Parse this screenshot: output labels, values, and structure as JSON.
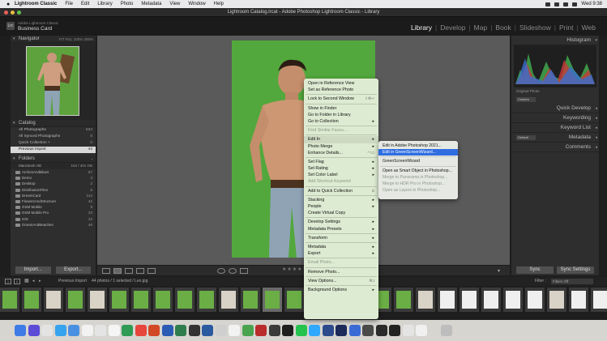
{
  "menubar": {
    "app": "Lightroom Classic",
    "items": [
      "File",
      "Edit",
      "Library",
      "Photo",
      "Metadata",
      "View",
      "Window",
      "Help"
    ],
    "clock": "Wed 9:38"
  },
  "window": {
    "title": "Lightroom Catalog.lrcat - Adobe Photoshop Lightroom Classic - Library"
  },
  "identity": {
    "badge": "Lrc",
    "line1": "Adobe Lightroom Classic",
    "line2": "Business Card",
    "modules": [
      "Library",
      "Develop",
      "Map",
      "Book",
      "Slideshow",
      "Print",
      "Web"
    ],
    "active_module": "Library"
  },
  "left_panel": {
    "navigator": {
      "title": "Navigator",
      "zoom": "FIT  FILL  100%  200%"
    },
    "catalog": {
      "title": "Catalog",
      "items": [
        {
          "label": "All Photographs",
          "count": "534"
        },
        {
          "label": "All Synced Photographs",
          "count": "0"
        },
        {
          "label": "Quick Collection +",
          "count": "0"
        },
        {
          "label": "Previous Import",
          "count": "44"
        }
      ],
      "selected": "Previous Import"
    },
    "folders": {
      "title": "Folders",
      "volume": {
        "label": "Macintosh HD",
        "count": "153 / 401 GB"
      },
      "items": [
        {
          "label": "ArchesAndBlues",
          "count": "57"
        },
        {
          "label": "Demo",
          "count": "4"
        },
        {
          "label": "Desktop",
          "count": "2"
        },
        {
          "label": "DistributionFiles",
          "count": "6"
        },
        {
          "label": "DreamCard",
          "count": "144"
        },
        {
          "label": "FlowersAndStructure",
          "count": "42"
        },
        {
          "label": "GSM Mobile",
          "count": "9"
        },
        {
          "label": "GSM Mobile Pro",
          "count": "23"
        },
        {
          "label": "IOS",
          "count": "22"
        },
        {
          "label": "OceanAndBeaches",
          "count": "46"
        }
      ]
    },
    "buttons": {
      "import": "Import...",
      "export": "Export..."
    }
  },
  "right_panel": {
    "histogram": "Histogram",
    "original_photo": "Original Photo",
    "saved_preset": "Custom",
    "sections": [
      "Quick Develop",
      "Keywording",
      "Keyword List",
      "Metadata",
      "Comments"
    ],
    "metadata_preset": "Default",
    "buttons": {
      "sync": "Sync",
      "sync_settings": "Sync Settings"
    }
  },
  "filmstrip": {
    "page1": "1",
    "page2": "2",
    "source": "Previous Import",
    "info": "44 photos / 1 selected / Leo.jpg",
    "filter_label": "Filter :",
    "filter_value": "Filters Off"
  },
  "context_menu": {
    "items": [
      {
        "label": "Open in Reference View",
        "state": "normal"
      },
      {
        "label": "Set as Reference Photo",
        "state": "normal"
      },
      {
        "sep": true
      },
      {
        "label": "Lock to Second Window",
        "shortcut": "⇧⌘↩",
        "state": "normal"
      },
      {
        "sep": true
      },
      {
        "label": "Show in Finder",
        "state": "normal"
      },
      {
        "label": "Go to Folder in Library",
        "state": "normal"
      },
      {
        "label": "Go to Collection",
        "arrow": "▸",
        "state": "normal"
      },
      {
        "sep": true
      },
      {
        "label": "Find Similar Faces...",
        "state": "disabled"
      },
      {
        "sep": true
      },
      {
        "label": "Edit In",
        "arrow": "▸",
        "state": "highlight"
      },
      {
        "label": "Photo Merge",
        "arrow": "▸",
        "state": "normal"
      },
      {
        "label": "Enhance Details...",
        "shortcut": "^⌥I",
        "state": "normal"
      },
      {
        "sep": true
      },
      {
        "label": "Set Flag",
        "arrow": "▸",
        "state": "normal"
      },
      {
        "label": "Set Rating",
        "arrow": "▸",
        "state": "normal"
      },
      {
        "label": "Set Color Label",
        "arrow": "▸",
        "state": "normal"
      },
      {
        "label": "Add Shortcut Keyword",
        "state": "disabled"
      },
      {
        "sep": true
      },
      {
        "label": "Add to Quick Collection",
        "shortcut": "B",
        "state": "normal"
      },
      {
        "sep": true
      },
      {
        "label": "Stacking",
        "arrow": "▸",
        "state": "normal"
      },
      {
        "label": "People",
        "arrow": "▸",
        "state": "normal"
      },
      {
        "label": "Create Virtual Copy",
        "state": "normal"
      },
      {
        "sep": true
      },
      {
        "label": "Develop Settings",
        "arrow": "▸",
        "state": "normal"
      },
      {
        "label": "Metadata Presets",
        "arrow": "▸",
        "state": "normal"
      },
      {
        "sep": true
      },
      {
        "label": "Transform",
        "arrow": "▸",
        "state": "normal"
      },
      {
        "sep": true
      },
      {
        "label": "Metadata",
        "arrow": "▸",
        "state": "normal"
      },
      {
        "label": "Export",
        "arrow": "▸",
        "state": "normal"
      },
      {
        "sep": true
      },
      {
        "label": "Email Photo...",
        "state": "disabled"
      },
      {
        "sep": true
      },
      {
        "label": "Remove Photo...",
        "state": "normal"
      },
      {
        "sep": true
      },
      {
        "label": "View Options...",
        "shortcut": "⌘J",
        "state": "normal"
      },
      {
        "sep": true
      },
      {
        "label": "Background Options",
        "arrow": "▸",
        "state": "normal"
      }
    ]
  },
  "submenu": {
    "items": [
      {
        "label": "Edit in Adobe Photoshop 2021...",
        "state": "normal"
      },
      {
        "label": "Edit in GreenScreenWizard...",
        "state": "selected"
      },
      {
        "sep": true
      },
      {
        "label": "GreenScreenWizard",
        "state": "normal"
      },
      {
        "sep": true
      },
      {
        "label": "Open as Smart Object in Photoshop...",
        "state": "normal"
      },
      {
        "label": "Merge to Panorama in Photoshop...",
        "state": "disabled"
      },
      {
        "label": "Merge to HDR Pro in Photoshop...",
        "state": "disabled"
      },
      {
        "label": "Open as Layers in Photoshop...",
        "state": "disabled"
      }
    ]
  },
  "colors": {
    "green_screen": "#52a83c",
    "menu_bg": "#ddebd2",
    "selection": "#2f6de0"
  }
}
